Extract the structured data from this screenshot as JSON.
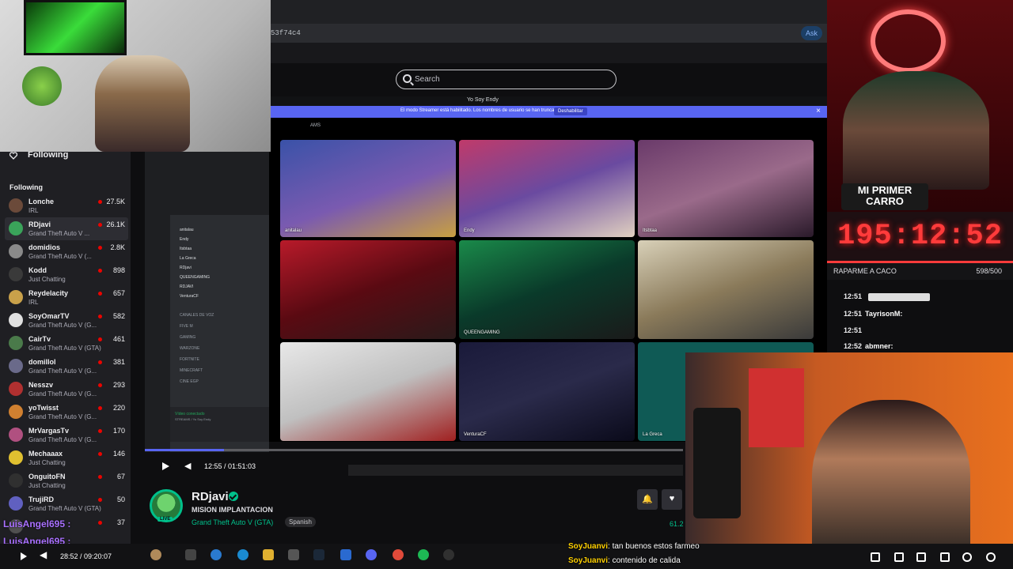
{
  "browser": {
    "url_fragment": "53f74c4",
    "ask_button": "Ask"
  },
  "site": {
    "search_placeholder": "Search"
  },
  "discord": {
    "server_title": "Yo Soy Endy",
    "streamer_notice": "El modo Streamer está habilitado. Los nombres de usuario se han truncado.",
    "disable_button": "Deshabilitar",
    "streams_label": "AMS",
    "voice_status": "Vídeo conectado",
    "voice_sub": "STREAMS / Yo Soy Endy",
    "channels_header": "CANALES DE VOZ",
    "channels": [
      "FIVE M",
      "GAMING",
      "WARZONE",
      "FORTNITE",
      "MINECRAFT",
      "CINE EGP"
    ],
    "members": [
      "anitalau",
      "Endy",
      "Itsbtaa",
      "La Greca",
      "RDjavi",
      "QUEENGAMING",
      "RDJAVI",
      "VenturaCF"
    ],
    "tiles": [
      {
        "name": "anitalau"
      },
      {
        "name": "Endy"
      },
      {
        "name": "Itsbtaa"
      },
      {
        "name": ""
      },
      {
        "name": "QUEENGAMING"
      },
      {
        "name": ""
      },
      {
        "name": ""
      },
      {
        "name": "VenturaCF"
      },
      {
        "name": "La Greca"
      }
    ]
  },
  "player": {
    "time": "12:55 / 01:51:03"
  },
  "channel": {
    "name": "RDjavi",
    "live_badge": "LIVE",
    "title": "MISION IMPLANTACION",
    "game": "Grand Theft Auto V (GTA)",
    "language": "Spanish",
    "viewers": "61.2"
  },
  "sidebar": {
    "header": "Following",
    "section": "Following",
    "channels": [
      {
        "name": "Lonche",
        "game": "IRL",
        "viewers": "27.5K",
        "color": "#6b4a3a"
      },
      {
        "name": "RDjavi",
        "game": "Grand Theft Auto V ...",
        "viewers": "26.1K",
        "color": "#3aa35a"
      },
      {
        "name": "domidios",
        "game": "Grand Theft Auto V (...",
        "viewers": "2.8K",
        "color": "#8a8a8a"
      },
      {
        "name": "Kodd",
        "game": "Just Chatting",
        "viewers": "898",
        "color": "#3a3a3a"
      },
      {
        "name": "Reydelacity",
        "game": "IRL",
        "viewers": "657",
        "color": "#c9a14a"
      },
      {
        "name": "SoyOmarTV",
        "game": "Grand Theft Auto V (G...",
        "viewers": "582",
        "color": "#e0e0e0"
      },
      {
        "name": "CairTv",
        "game": "Grand Theft Auto V (GTA)",
        "viewers": "461",
        "color": "#4a7a4a"
      },
      {
        "name": "domilIol",
        "game": "Grand Theft Auto V (G...",
        "viewers": "381",
        "color": "#6a6a8a"
      },
      {
        "name": "Nesszv",
        "game": "Grand Theft Auto V (G...",
        "viewers": "293",
        "color": "#b03030"
      },
      {
        "name": "yoTwisst",
        "game": "Grand Theft Auto V (G...",
        "viewers": "220",
        "color": "#d08030"
      },
      {
        "name": "MrVargasTv",
        "game": "Grand Theft Auto V (G...",
        "viewers": "170",
        "color": "#b05080"
      },
      {
        "name": "Mechaaax",
        "game": "Just Chatting",
        "viewers": "146",
        "color": "#e0c030"
      },
      {
        "name": "OnguitoFN",
        "game": "Just Chatting",
        "viewers": "67",
        "color": "#303030"
      },
      {
        "name": "TrujiRD",
        "game": "Grand Theft Auto V (GTA)",
        "viewers": "50",
        "color": "#6060c0"
      },
      {
        "name": "",
        "game": "",
        "viewers": "37",
        "color": "#505050"
      }
    ]
  },
  "overlay_chat_left": [
    "LuisAngel695 :",
    "LuisAngel695 :"
  ],
  "bottom_bar": {
    "time": "28:52 / 09:20:07"
  },
  "cam_top_right": {
    "sign_line1": "MI PRIMER",
    "sign_line2": "CARRO"
  },
  "timer": {
    "value": "195:12:52",
    "label": "RAPARME A CACO",
    "count": "598/500",
    "progress": 1.0
  },
  "mini_chat": [
    {
      "time": "12:51",
      "user": "",
      "color": "#ff4d4d"
    },
    {
      "time": "12:51",
      "user": "TayrisonM:",
      "color": "#ffffff"
    },
    {
      "time": "12:51",
      "user": "",
      "color": "#ff4d4d"
    },
    {
      "time": "12:52",
      "user": "abmner:",
      "color": "#ffffff"
    }
  ],
  "overlay_chat": [
    {
      "user": "SoyJuanvi",
      "text": ": tan buenos estos farmeo"
    },
    {
      "user": "SoyJuanvi",
      "text": ": contenido de calida"
    }
  ]
}
